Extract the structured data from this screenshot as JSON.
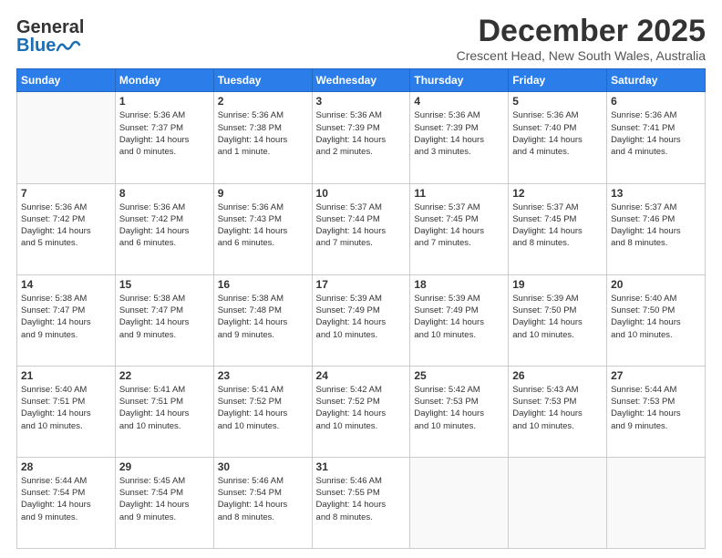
{
  "header": {
    "logo_general": "General",
    "logo_blue": "Blue",
    "month_title": "December 2025",
    "location": "Crescent Head, New South Wales, Australia"
  },
  "days_of_week": [
    "Sunday",
    "Monday",
    "Tuesday",
    "Wednesday",
    "Thursday",
    "Friday",
    "Saturday"
  ],
  "weeks": [
    [
      {
        "day": "",
        "info": ""
      },
      {
        "day": "1",
        "info": "Sunrise: 5:36 AM\nSunset: 7:37 PM\nDaylight: 14 hours\nand 0 minutes."
      },
      {
        "day": "2",
        "info": "Sunrise: 5:36 AM\nSunset: 7:38 PM\nDaylight: 14 hours\nand 1 minute."
      },
      {
        "day": "3",
        "info": "Sunrise: 5:36 AM\nSunset: 7:39 PM\nDaylight: 14 hours\nand 2 minutes."
      },
      {
        "day": "4",
        "info": "Sunrise: 5:36 AM\nSunset: 7:39 PM\nDaylight: 14 hours\nand 3 minutes."
      },
      {
        "day": "5",
        "info": "Sunrise: 5:36 AM\nSunset: 7:40 PM\nDaylight: 14 hours\nand 4 minutes."
      },
      {
        "day": "6",
        "info": "Sunrise: 5:36 AM\nSunset: 7:41 PM\nDaylight: 14 hours\nand 4 minutes."
      }
    ],
    [
      {
        "day": "7",
        "info": "Sunrise: 5:36 AM\nSunset: 7:42 PM\nDaylight: 14 hours\nand 5 minutes."
      },
      {
        "day": "8",
        "info": "Sunrise: 5:36 AM\nSunset: 7:42 PM\nDaylight: 14 hours\nand 6 minutes."
      },
      {
        "day": "9",
        "info": "Sunrise: 5:36 AM\nSunset: 7:43 PM\nDaylight: 14 hours\nand 6 minutes."
      },
      {
        "day": "10",
        "info": "Sunrise: 5:37 AM\nSunset: 7:44 PM\nDaylight: 14 hours\nand 7 minutes."
      },
      {
        "day": "11",
        "info": "Sunrise: 5:37 AM\nSunset: 7:45 PM\nDaylight: 14 hours\nand 7 minutes."
      },
      {
        "day": "12",
        "info": "Sunrise: 5:37 AM\nSunset: 7:45 PM\nDaylight: 14 hours\nand 8 minutes."
      },
      {
        "day": "13",
        "info": "Sunrise: 5:37 AM\nSunset: 7:46 PM\nDaylight: 14 hours\nand 8 minutes."
      }
    ],
    [
      {
        "day": "14",
        "info": "Sunrise: 5:38 AM\nSunset: 7:47 PM\nDaylight: 14 hours\nand 9 minutes."
      },
      {
        "day": "15",
        "info": "Sunrise: 5:38 AM\nSunset: 7:47 PM\nDaylight: 14 hours\nand 9 minutes."
      },
      {
        "day": "16",
        "info": "Sunrise: 5:38 AM\nSunset: 7:48 PM\nDaylight: 14 hours\nand 9 minutes."
      },
      {
        "day": "17",
        "info": "Sunrise: 5:39 AM\nSunset: 7:49 PM\nDaylight: 14 hours\nand 10 minutes."
      },
      {
        "day": "18",
        "info": "Sunrise: 5:39 AM\nSunset: 7:49 PM\nDaylight: 14 hours\nand 10 minutes."
      },
      {
        "day": "19",
        "info": "Sunrise: 5:39 AM\nSunset: 7:50 PM\nDaylight: 14 hours\nand 10 minutes."
      },
      {
        "day": "20",
        "info": "Sunrise: 5:40 AM\nSunset: 7:50 PM\nDaylight: 14 hours\nand 10 minutes."
      }
    ],
    [
      {
        "day": "21",
        "info": "Sunrise: 5:40 AM\nSunset: 7:51 PM\nDaylight: 14 hours\nand 10 minutes."
      },
      {
        "day": "22",
        "info": "Sunrise: 5:41 AM\nSunset: 7:51 PM\nDaylight: 14 hours\nand 10 minutes."
      },
      {
        "day": "23",
        "info": "Sunrise: 5:41 AM\nSunset: 7:52 PM\nDaylight: 14 hours\nand 10 minutes."
      },
      {
        "day": "24",
        "info": "Sunrise: 5:42 AM\nSunset: 7:52 PM\nDaylight: 14 hours\nand 10 minutes."
      },
      {
        "day": "25",
        "info": "Sunrise: 5:42 AM\nSunset: 7:53 PM\nDaylight: 14 hours\nand 10 minutes."
      },
      {
        "day": "26",
        "info": "Sunrise: 5:43 AM\nSunset: 7:53 PM\nDaylight: 14 hours\nand 10 minutes."
      },
      {
        "day": "27",
        "info": "Sunrise: 5:44 AM\nSunset: 7:53 PM\nDaylight: 14 hours\nand 9 minutes."
      }
    ],
    [
      {
        "day": "28",
        "info": "Sunrise: 5:44 AM\nSunset: 7:54 PM\nDaylight: 14 hours\nand 9 minutes."
      },
      {
        "day": "29",
        "info": "Sunrise: 5:45 AM\nSunset: 7:54 PM\nDaylight: 14 hours\nand 9 minutes."
      },
      {
        "day": "30",
        "info": "Sunrise: 5:46 AM\nSunset: 7:54 PM\nDaylight: 14 hours\nand 8 minutes."
      },
      {
        "day": "31",
        "info": "Sunrise: 5:46 AM\nSunset: 7:55 PM\nDaylight: 14 hours\nand 8 minutes."
      },
      {
        "day": "",
        "info": ""
      },
      {
        "day": "",
        "info": ""
      },
      {
        "day": "",
        "info": ""
      }
    ]
  ]
}
